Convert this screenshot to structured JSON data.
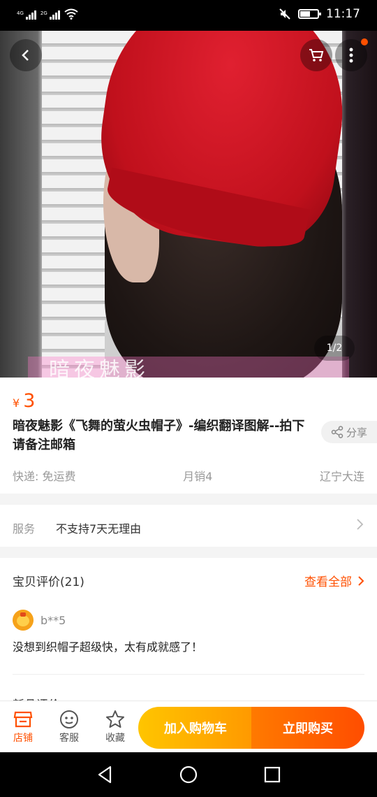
{
  "status_bar": {
    "sim1": "4G",
    "sim2": "2G",
    "time": "11:17"
  },
  "hero": {
    "caption": "暗夜魅影",
    "pager": "1/2"
  },
  "product": {
    "currency": "¥",
    "price": "3",
    "title": "暗夜魅影《飞舞的萤火虫帽子》-编织翻译图解--拍下请备注邮箱",
    "share_label": "分享",
    "shipping": "快递: 免运费",
    "monthly_sales": "月销4",
    "location": "辽宁大连"
  },
  "service": {
    "label": "服务",
    "value": "不支持7天无理由"
  },
  "reviews": {
    "title": "宝贝评价(21)",
    "view_all": "查看全部",
    "items": [
      {
        "user": "b**5",
        "text": "没想到织帽子超级快，太有成就感了！"
      }
    ],
    "next_section": "新品评价"
  },
  "bottom_bar": {
    "shop_label": "店铺",
    "service_label": "客服",
    "favorite_label": "收藏",
    "add_cart_label": "加入购物车",
    "buy_now_label": "立即购买"
  },
  "colors": {
    "accent": "#ff5000",
    "cart_button": "#ffb000",
    "buy_button": "#ff6000"
  }
}
